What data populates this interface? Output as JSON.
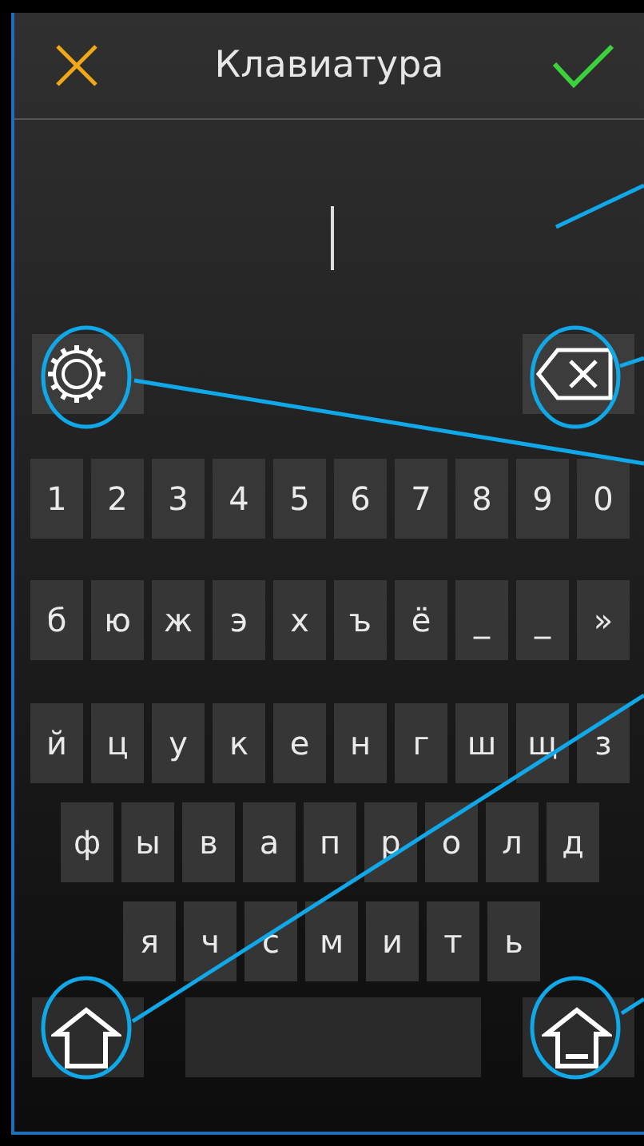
{
  "header": {
    "title": "Клавиатура"
  },
  "keyboard": {
    "rows": [
      [
        "1",
        "2",
        "3",
        "4",
        "5",
        "6",
        "7",
        "8",
        "9",
        "0"
      ],
      [
        "б",
        "ю",
        "ж",
        "э",
        "х",
        "ъ",
        "ё",
        "_",
        "_",
        "»"
      ],
      [
        "й",
        "ц",
        "у",
        "к",
        "е",
        "н",
        "г",
        "ш",
        "щ",
        "з"
      ],
      [
        "ф",
        "ы",
        "в",
        "а",
        "п",
        "р",
        "о",
        "л",
        "д"
      ],
      [
        "я",
        "ч",
        "с",
        "м",
        "и",
        "т",
        "ь"
      ]
    ]
  }
}
